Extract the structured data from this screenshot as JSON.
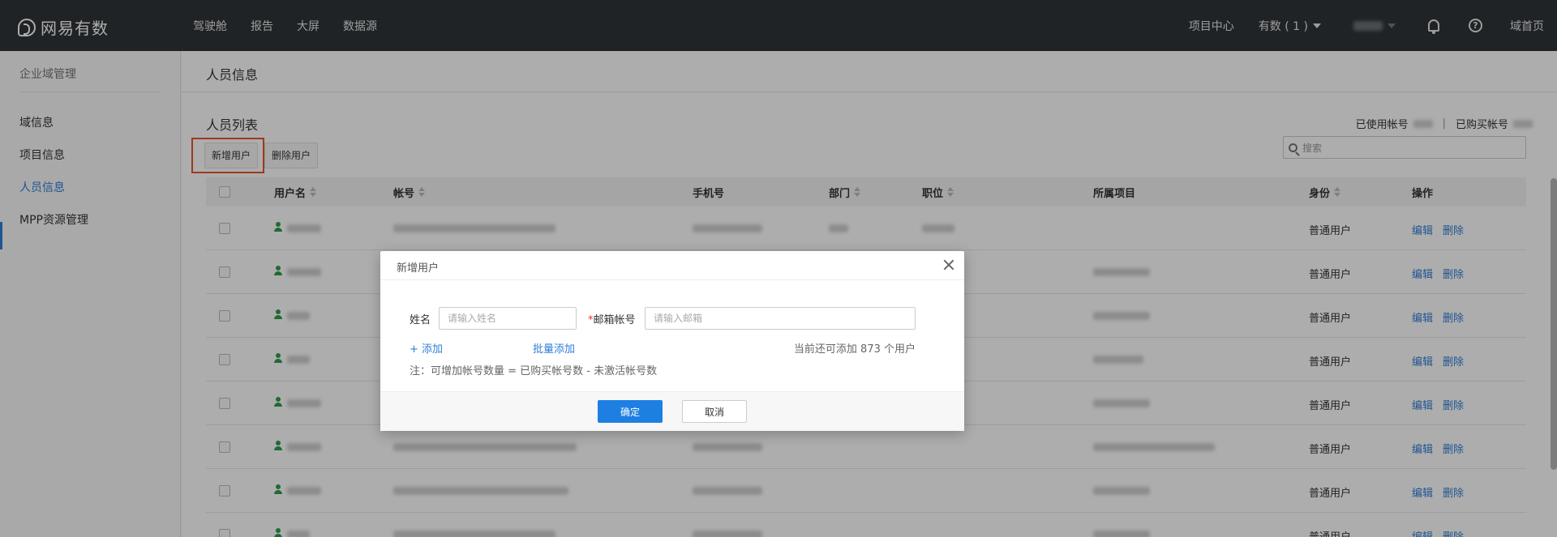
{
  "topbar": {
    "logo_text": "网易有数",
    "nav": [
      "驾驶舱",
      "报告",
      "大屏",
      "数据源"
    ],
    "project_center": "项目中心",
    "youshu_dropdown": "有数 ( 1 )",
    "home": "域首页"
  },
  "sidebar": {
    "title": "企业域管理",
    "items": [
      "域信息",
      "项目信息",
      "人员信息",
      "MPP资源管理"
    ],
    "active_index": 2
  },
  "main": {
    "page_title": "人员信息",
    "list_title": "人员列表",
    "stats": {
      "used_label": "已使用帐号",
      "purchased_label": "已购买帐号"
    },
    "add_user_btn": "新增用户",
    "delete_user_btn": "删除用户",
    "search_placeholder": "搜索",
    "columns": [
      "用户名",
      "帐号",
      "手机号",
      "部门",
      "职位",
      "所属项目",
      "身份",
      "操作"
    ],
    "rows": [
      {
        "role": "普通用户",
        "edit": "编辑",
        "delete": "删除"
      },
      {
        "role": "普通用户",
        "edit": "编辑",
        "delete": "删除"
      },
      {
        "role": "普通用户",
        "edit": "编辑",
        "delete": "删除"
      },
      {
        "role": "普通用户",
        "edit": "编辑",
        "delete": "删除"
      },
      {
        "role": "普通用户",
        "edit": "编辑",
        "delete": "删除"
      },
      {
        "role": "普通用户",
        "edit": "编辑",
        "delete": "删除"
      },
      {
        "role": "普通用户",
        "edit": "编辑",
        "delete": "删除"
      },
      {
        "role": "普通用户",
        "edit": "编辑",
        "delete": "删除"
      }
    ]
  },
  "modal": {
    "title": "新增用户",
    "name_label": "姓名",
    "name_placeholder": "请输入姓名",
    "email_required_mark": "*",
    "email_label": "邮箱帐号",
    "email_placeholder": "请输入邮箱",
    "add_link": "+ 添加",
    "batch_add_link": "批量添加",
    "remaining_text": "当前还可添加 873 个用户",
    "note": "注：可增加帐号数量 = 已购买帐号数 - 未激活帐号数",
    "confirm_btn": "确定",
    "cancel_btn": "取消"
  },
  "colors": {
    "topbar_bg": "#2f3438",
    "accent": "#1e7fe2",
    "highlight": "#e8552e",
    "user_icon": "#2e9e4c"
  }
}
